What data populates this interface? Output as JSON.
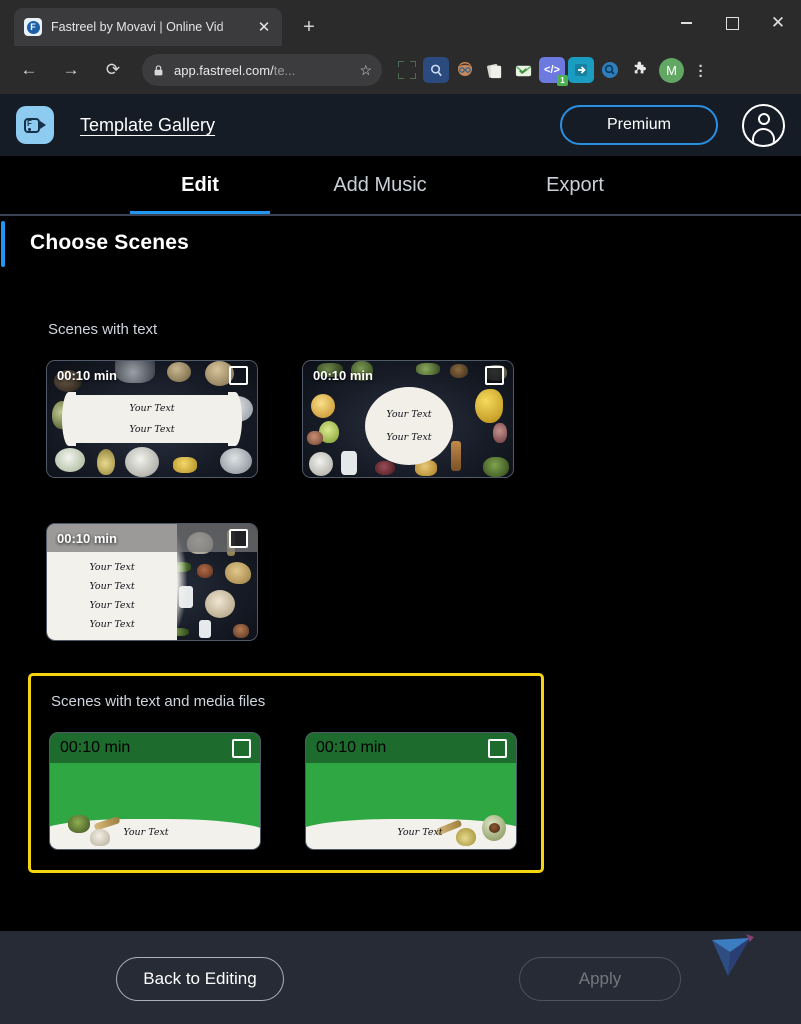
{
  "browser": {
    "tab": {
      "title": "Fastreel by Movavi | Online Vid",
      "favicon_letter": "F",
      "close_label": "✕"
    },
    "new_tab_label": "+",
    "window_controls": {
      "minimize": "",
      "maximize": "",
      "close": "✕"
    },
    "nav": {
      "back": "←",
      "forward": "→",
      "reload": "⟳"
    },
    "omnibox": {
      "url_main": "app.fastreel.com/",
      "url_dim": "te...",
      "bookmark_star": "☆"
    },
    "extensions": [
      {
        "name": "screen-capture-icon",
        "glyph": "",
        "color": "transparent",
        "badge": ""
      },
      {
        "name": "search-magnifier-extension-icon",
        "glyph": "⌕",
        "color": "#2b4a7d",
        "badge": ""
      },
      {
        "name": "avatar-face-extension-icon",
        "glyph": "◕",
        "color": "#c98a5d",
        "badge": ""
      },
      {
        "name": "papers-extension-icon",
        "glyph": "◧",
        "color": "#cfcfc4",
        "badge": ""
      },
      {
        "name": "mail-check-extension-icon",
        "glyph": "✓",
        "color": "#e4f0e0",
        "badge": ""
      },
      {
        "name": "code-extension-icon",
        "glyph": "‹›",
        "color": "#6c7ae0",
        "badge": "1"
      },
      {
        "name": "export-arrow-extension-icon",
        "glyph": "→",
        "color": "#1a9dc0",
        "badge": ""
      },
      {
        "name": "search-circle-extension-icon",
        "glyph": "⌕",
        "color": "#2f7fbf",
        "badge": ""
      },
      {
        "name": "puzzle-extensions-icon",
        "glyph": "❖",
        "color": "transparent",
        "badge": ""
      }
    ],
    "profile_initial": "M",
    "menu_label": "⋮"
  },
  "app": {
    "header": {
      "logo_letter": "F",
      "gallery_link": "Template Gallery",
      "premium_label": "Premium",
      "account_icon": "account-avatar-icon"
    },
    "tabs": [
      {
        "label": "Edit",
        "active": true
      },
      {
        "label": "Add Music",
        "active": false
      },
      {
        "label": "Export",
        "active": false
      }
    ],
    "page_title": "Choose Scenes",
    "groups": [
      {
        "label": "Scenes with text",
        "highlighted": false,
        "cards": [
          {
            "duration": "00:10 min",
            "text_lines": [
              "Your Text",
              "Your Text"
            ],
            "style": "dark-board-rect",
            "checked": false
          },
          {
            "duration": "00:10 min",
            "text_lines": [
              "Your Text",
              "Your Text"
            ],
            "style": "dark-board-circle",
            "checked": false
          },
          {
            "duration": "00:10 min",
            "text_lines": [
              "Your Text",
              "Your Text",
              "Your Text",
              "Your Text"
            ],
            "style": "dark-board-split",
            "checked": false
          }
        ]
      },
      {
        "label": "Scenes with text and media files",
        "highlighted": true,
        "highlight_color": "#f5d410",
        "cards": [
          {
            "duration": "00:10 min",
            "text_lines": [
              "Your Text"
            ],
            "style": "green-media-right",
            "checked": false
          },
          {
            "duration": "00:10 min",
            "text_lines": [
              "Your Text"
            ],
            "style": "green-media-left",
            "checked": false
          }
        ]
      }
    ],
    "footer": {
      "back_label": "Back to Editing",
      "apply_label": "Apply",
      "apply_disabled": true,
      "watermark": "movavi-triangle-logo"
    },
    "colors": {
      "accent_blue": "#2196f3",
      "premium_border": "#2a8fe0",
      "highlight_yellow": "#f5d410",
      "green_card": "#2fa844",
      "green_header": "#1e6b2e",
      "header_bg": "#161c26",
      "footer_bg": "#272b35"
    }
  }
}
